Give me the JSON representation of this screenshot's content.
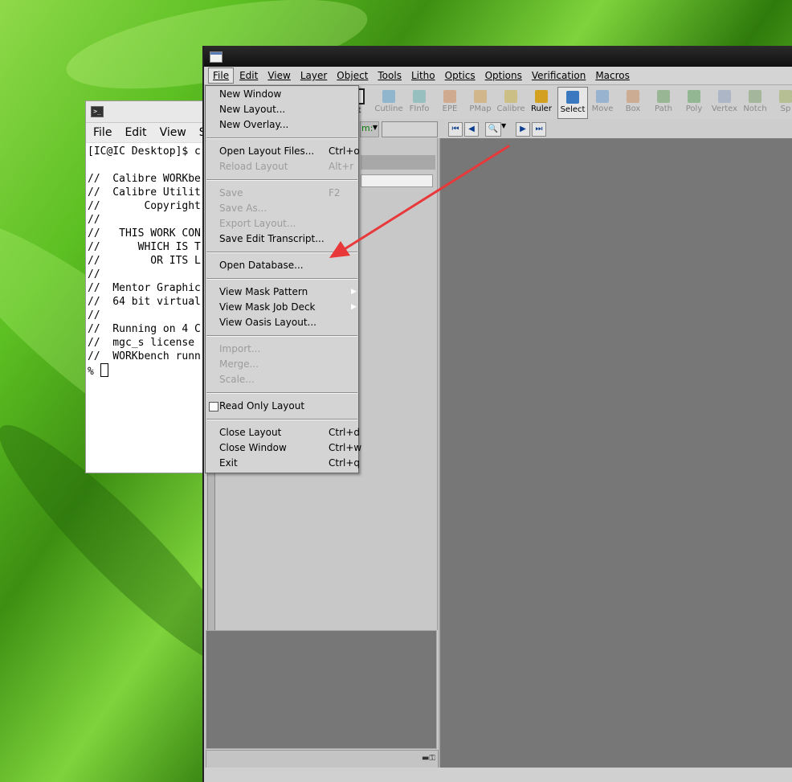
{
  "terminal": {
    "menu": [
      "File",
      "Edit",
      "View",
      "Se"
    ],
    "lines": [
      "[IC@IC Desktop]$ c",
      "",
      "//  Calibre WORKbe",
      "//  Calibre Utilit",
      "//       Copyright",
      "//",
      "//   THIS WORK CON",
      "//      WHICH IS T",
      "//        OR ITS L",
      "//",
      "//  Mentor Graphic",
      "//  64 bit virtual",
      "//",
      "//  Running on 4 C",
      "//  mgc_s license ",
      "//  WORKbench runn"
    ],
    "prompt": "% "
  },
  "calibre": {
    "menubar": [
      {
        "label": "File",
        "open": true
      },
      {
        "label": "Edit"
      },
      {
        "label": "View"
      },
      {
        "label": "Layer"
      },
      {
        "label": "Object"
      },
      {
        "label": "Tools"
      },
      {
        "label": "Litho"
      },
      {
        "label": "Optics"
      },
      {
        "label": "Options"
      },
      {
        "label": "Verification"
      },
      {
        "label": "Macros"
      }
    ],
    "toolbar": {
      "partial_label": "ct",
      "buttons": [
        {
          "label": "Cutline",
          "icon": "cutline-icon",
          "color": "#5aa0c8"
        },
        {
          "label": "FInfo",
          "icon": "finfo-icon",
          "color": "#6ab0b0"
        },
        {
          "label": "EPE",
          "icon": "epe-icon",
          "color": "#d08a5a"
        },
        {
          "label": "PMap",
          "icon": "pmap-icon",
          "color": "#d0a050"
        },
        {
          "label": "Calibre",
          "icon": "calibre-icon",
          "color": "#c8b048"
        },
        {
          "label": "Ruler",
          "icon": "ruler-icon",
          "color": "#d4a020"
        },
        {
          "label": "Select",
          "icon": "select-cursor-icon",
          "color": "#3a78c0"
        },
        {
          "label": "Move",
          "icon": "move-icon",
          "color": "#6a9ad0"
        },
        {
          "label": "Box",
          "icon": "box-icon",
          "color": "#c89060"
        },
        {
          "label": "Path",
          "icon": "path-icon",
          "color": "#6aa060"
        },
        {
          "label": "Poly",
          "icon": "poly-icon",
          "color": "#60a060"
        },
        {
          "label": "Vertex",
          "icon": "vertex-icon",
          "color": "#90a0c0"
        },
        {
          "label": "Notch",
          "icon": "notch-icon",
          "color": "#80a070"
        },
        {
          "label": "Sp",
          "icon": "split-icon",
          "color": "#a0b060"
        }
      ]
    },
    "navrow": {
      "combo_label": "m:",
      "input_value": ""
    }
  },
  "file_menu": {
    "items": [
      {
        "type": "item",
        "label": "New Window",
        "shortcut": "",
        "enabled": true
      },
      {
        "type": "item",
        "label": "New Layout...",
        "shortcut": "",
        "enabled": true
      },
      {
        "type": "item",
        "label": "New Overlay...",
        "shortcut": "",
        "enabled": true
      },
      {
        "type": "sep"
      },
      {
        "type": "item",
        "label": "Open Layout Files...",
        "shortcut": "Ctrl+o",
        "enabled": true
      },
      {
        "type": "item",
        "label": "Reload Layout",
        "shortcut": "Alt+r",
        "enabled": false
      },
      {
        "type": "sep"
      },
      {
        "type": "item",
        "label": "Save",
        "shortcut": "F2",
        "enabled": false
      },
      {
        "type": "item",
        "label": "Save As...",
        "shortcut": "",
        "enabled": false
      },
      {
        "type": "item",
        "label": "Export Layout...",
        "shortcut": "",
        "enabled": false
      },
      {
        "type": "item",
        "label": "Save Edit Transcript...",
        "shortcut": "",
        "enabled": true
      },
      {
        "type": "sep"
      },
      {
        "type": "item",
        "label": "Open Database...",
        "shortcut": "",
        "enabled": true
      },
      {
        "type": "sep"
      },
      {
        "type": "item",
        "label": "View Mask Pattern",
        "shortcut": "",
        "enabled": true,
        "submenu": true
      },
      {
        "type": "item",
        "label": "View Mask Job Deck",
        "shortcut": "",
        "enabled": true,
        "submenu": true
      },
      {
        "type": "item",
        "label": "View Oasis Layout...",
        "shortcut": "",
        "enabled": true
      },
      {
        "type": "sep"
      },
      {
        "type": "item",
        "label": "Import...",
        "shortcut": "",
        "enabled": false
      },
      {
        "type": "item",
        "label": "Merge...",
        "shortcut": "",
        "enabled": false
      },
      {
        "type": "item",
        "label": "Scale...",
        "shortcut": "",
        "enabled": false
      },
      {
        "type": "sep"
      },
      {
        "type": "check",
        "label": "Read Only Layout",
        "checked": false,
        "enabled": true
      },
      {
        "type": "sep"
      },
      {
        "type": "item",
        "label": "Close Layout",
        "shortcut": "Ctrl+d",
        "enabled": true
      },
      {
        "type": "item",
        "label": "Close Window",
        "shortcut": "Ctrl+w",
        "enabled": true
      },
      {
        "type": "item",
        "label": "Exit",
        "shortcut": "Ctrl+q",
        "enabled": true
      }
    ]
  },
  "annotation": {
    "color": "#e8383a"
  }
}
